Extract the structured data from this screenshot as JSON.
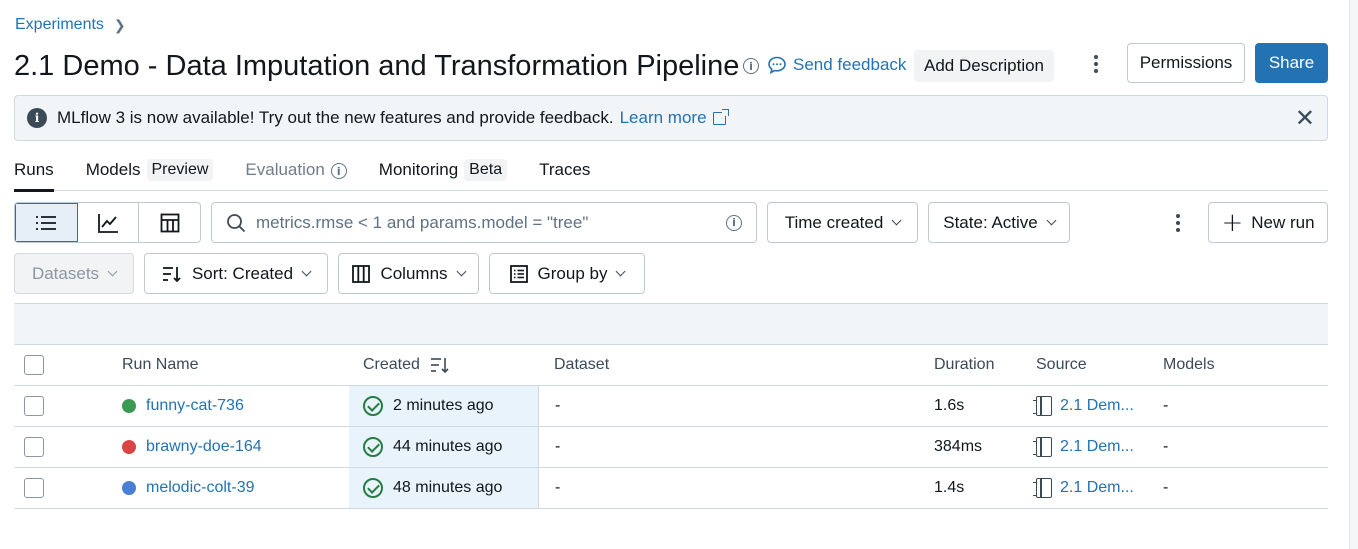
{
  "breadcrumb": {
    "experiments": "Experiments"
  },
  "header": {
    "title": "2.1 Demo - Data Imputation and Transformation Pipeline",
    "send_feedback": "Send feedback",
    "add_description": "Add Description",
    "permissions": "Permissions",
    "share": "Share"
  },
  "banner": {
    "text": "MLflow 3 is now available! Try out the new features and provide feedback.",
    "link": "Learn more"
  },
  "tabs": [
    {
      "label": "Runs",
      "tag": ""
    },
    {
      "label": "Models",
      "tag": "Preview"
    },
    {
      "label": "Evaluation",
      "tag": ""
    },
    {
      "label": "Monitoring",
      "tag": "Beta"
    },
    {
      "label": "Traces",
      "tag": ""
    }
  ],
  "toolbar": {
    "search_placeholder": "metrics.rmse < 1 and params.model = \"tree\"",
    "time_created": "Time created",
    "state": "State: Active",
    "new_run": "New run",
    "datasets": "Datasets",
    "sort": "Sort: Created",
    "columns": "Columns",
    "group_by": "Group by"
  },
  "table": {
    "headers": {
      "run_name": "Run Name",
      "created": "Created",
      "dataset": "Dataset",
      "duration": "Duration",
      "source": "Source",
      "models": "Models"
    },
    "rows": [
      {
        "name": "funny-cat-736",
        "color": "#3a9a52",
        "created": "2 minutes ago",
        "dataset": "-",
        "duration": "1.6s",
        "source": "2.1 Dem...",
        "models": "-"
      },
      {
        "name": "brawny-doe-164",
        "color": "#d94545",
        "created": "44 minutes ago",
        "dataset": "-",
        "duration": "384ms",
        "source": "2.1 Dem...",
        "models": "-"
      },
      {
        "name": "melodic-colt-39",
        "color": "#4a7fd6",
        "created": "48 minutes ago",
        "dataset": "-",
        "duration": "1.4s",
        "source": "2.1 Dem...",
        "models": "-"
      }
    ]
  },
  "colors": {
    "accent": "#2272b4",
    "success": "#277c43"
  }
}
